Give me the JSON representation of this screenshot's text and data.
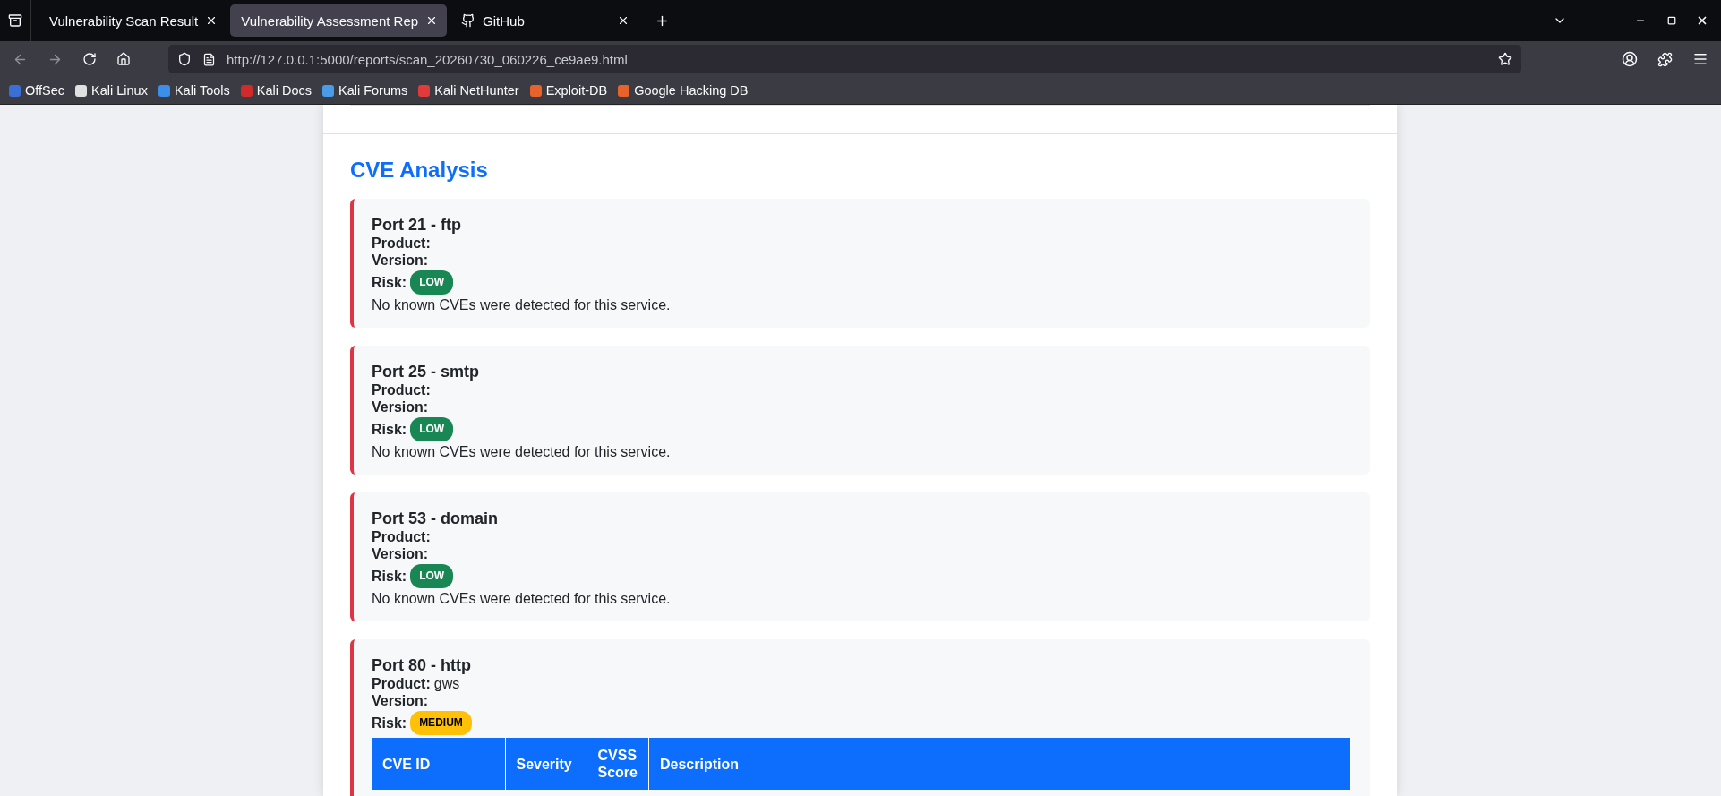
{
  "browser": {
    "tabs": [
      {
        "title": "Vulnerability Scan Result",
        "selected": false,
        "kind": "plain"
      },
      {
        "title": "Vulnerability Assessment Rep",
        "selected": true,
        "kind": "plain"
      },
      {
        "title": "GitHub",
        "selected": false,
        "kind": "favicon"
      }
    ],
    "url": "http://127.0.0.1:5000/reports/scan_20260730_060226_ce9ae9.html",
    "bookmarks": [
      {
        "label": "OffSec",
        "color": "#3b6fd8"
      },
      {
        "label": "Kali Linux",
        "color": "#e0e0e0"
      },
      {
        "label": "Kali Tools",
        "color": "#3b8fe8"
      },
      {
        "label": "Kali Docs",
        "color": "#d02a2a"
      },
      {
        "label": "Kali Forums",
        "color": "#4a9be8"
      },
      {
        "label": "Kali NetHunter",
        "color": "#e03a3a"
      },
      {
        "label": "Exploit-DB",
        "color": "#e8632a"
      },
      {
        "label": "Google Hacking DB",
        "color": "#e8632a"
      }
    ]
  },
  "report": {
    "section_title": "CVE Analysis",
    "cards": [
      {
        "title": "Port 21 - ftp",
        "product_label": "Product:",
        "version_label": "Version:",
        "risk_label": "Risk:",
        "risk": "LOW",
        "color": "#198754",
        "message": "No known CVEs were detected for this service."
      },
      {
        "title": "Port 25 - smtp",
        "product_label": "Product:",
        "version_label": "Version:",
        "risk_label": "Risk:",
        "risk": "LOW",
        "color": "#198754",
        "message": "No known CVEs were detected for this service."
      },
      {
        "title": "Port 53 - domain",
        "product_label": "Product:",
        "version_label": "Version:",
        "risk_label": "Risk:",
        "risk": "LOW",
        "color": "#198754",
        "message": "No known CVEs were detected for this service."
      },
      {
        "title": "Port 80 - http",
        "product_label": "Product:",
        "product": "gws",
        "version_label": "Version:",
        "risk_label": "Risk:",
        "risk": "MEDIUM",
        "color": "#ffc107",
        "columns": [
          "CVE ID",
          "Severity",
          "CVSS Score",
          "Description"
        ]
      }
    ]
  }
}
